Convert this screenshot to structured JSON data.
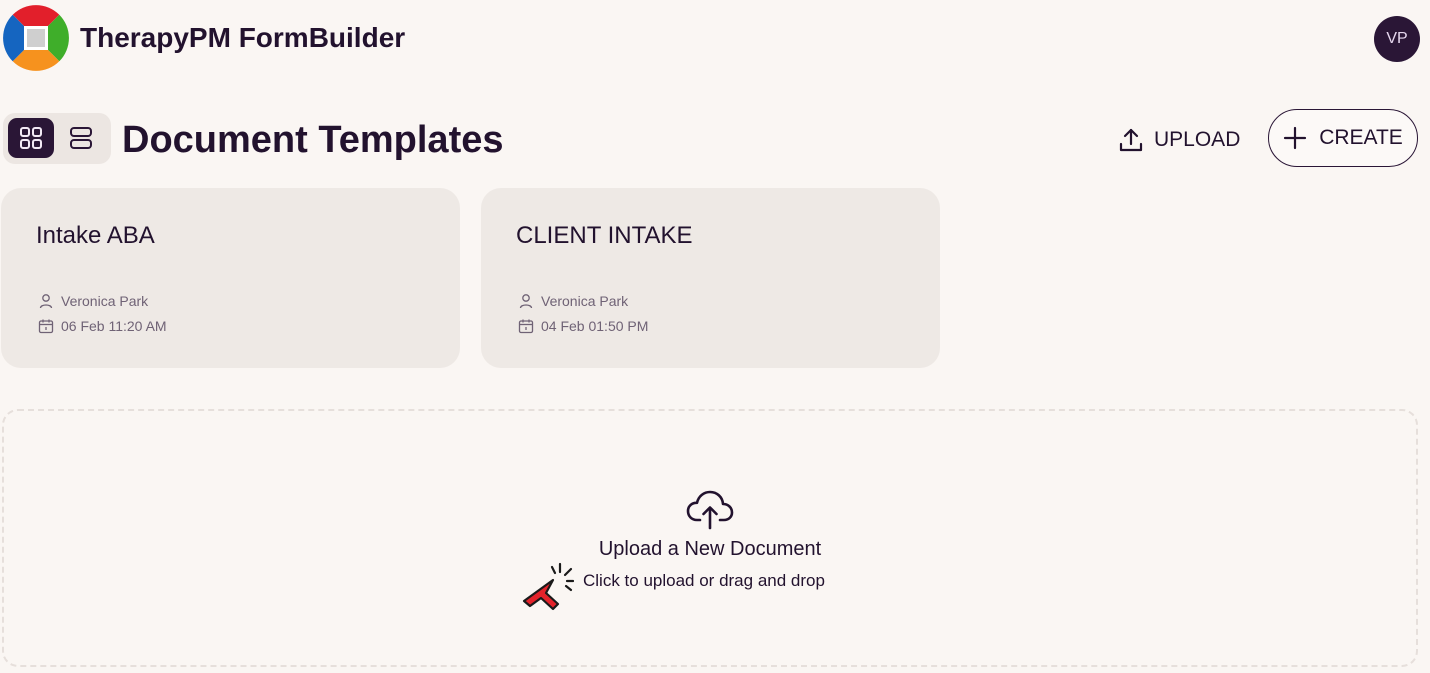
{
  "app": {
    "title": "TherapyPM FormBuilder",
    "logo_icon": "therapypm-logo-icon",
    "user_initials": "VP"
  },
  "toolbar": {
    "page_title": "Document Templates",
    "grid_view_icon": "grid-view-icon",
    "list_view_icon": "list-view-icon",
    "selected_view": "grid",
    "upload_label": "UPLOAD",
    "create_label": "CREATE"
  },
  "templates": [
    {
      "title": "Intake ABA",
      "author": "Veronica Park",
      "date": "06 Feb 11:20 AM"
    },
    {
      "title": "CLIENT INTAKE",
      "author": "Veronica Park",
      "date": "04 Feb 01:50 PM"
    }
  ],
  "dropzone": {
    "icon": "cloud-upload-icon",
    "title": "Upload a New Document",
    "subtitle": "Click to upload or drag and drop"
  },
  "colors": {
    "background": "#faf6f3",
    "primary": "#2a1636",
    "card": "#eee9e5",
    "muted_text": "#6f6275",
    "cursor_red": "#e4232b"
  }
}
